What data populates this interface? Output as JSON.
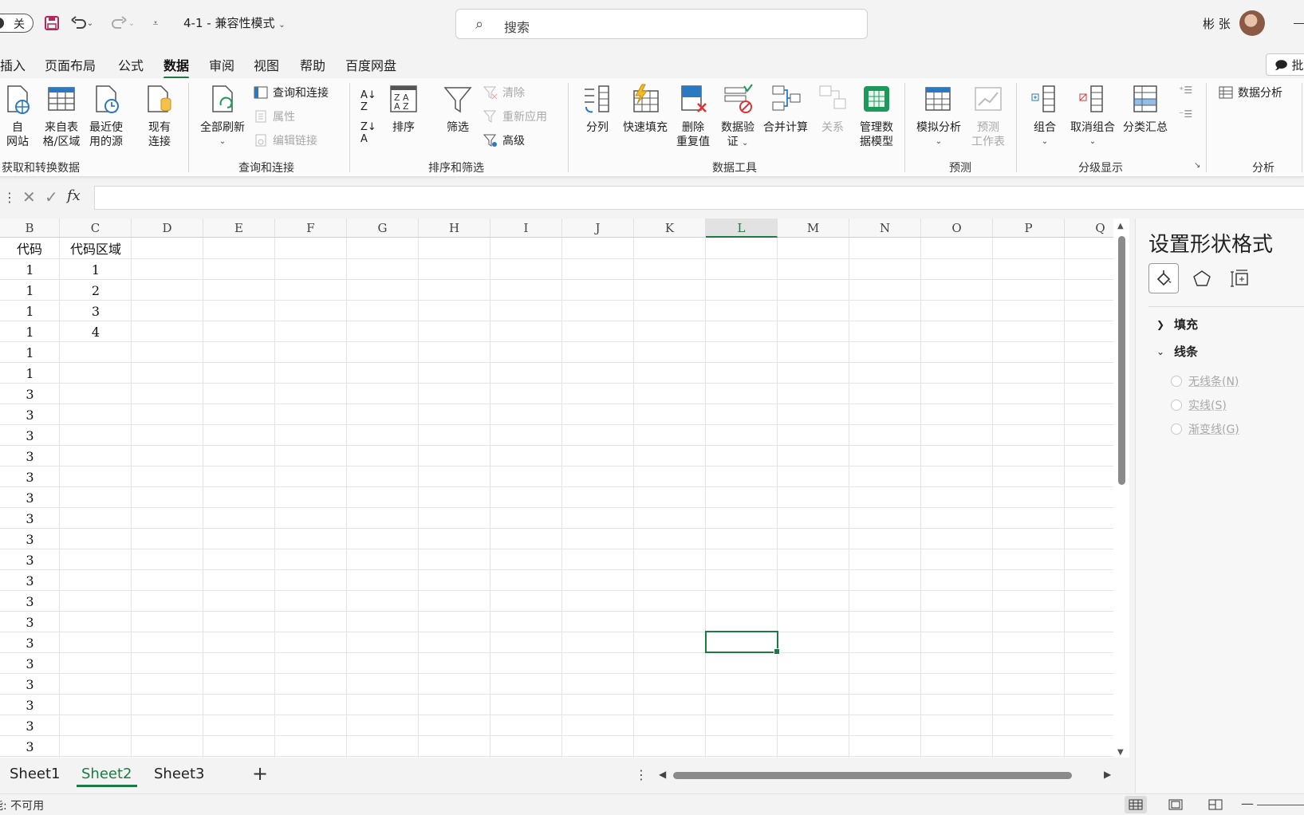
{
  "titlebar": {
    "autosave_label": "关",
    "doc_title": "4-1 - 兼容性模式",
    "search_placeholder": "搜索",
    "user_name": "彬 张"
  },
  "tabs": [
    {
      "label": "插入",
      "active": false
    },
    {
      "label": "页面布局",
      "active": false
    },
    {
      "label": "公式",
      "active": false
    },
    {
      "label": "数据",
      "active": true
    },
    {
      "label": "审阅",
      "active": false
    },
    {
      "label": "视图",
      "active": false
    },
    {
      "label": "帮助",
      "active": false
    },
    {
      "label": "百度网盘",
      "active": false
    }
  ],
  "comment_button": "批注",
  "ribbon": {
    "get_data": {
      "group_label": "获取和转换数据",
      "from_web": "自\n网站",
      "from_table": "来自表\n格/区域",
      "recent_sources": "最近使\n用的源",
      "existing_conn": "现有\n连接"
    },
    "queries": {
      "group_label": "查询和连接",
      "refresh_all": "全部刷新",
      "queries_conn": "查询和连接",
      "properties": "属性",
      "edit_links": "编辑链接"
    },
    "sort_filter": {
      "group_label": "排序和筛选",
      "sort": "排序",
      "filter": "筛选",
      "clear": "清除",
      "reapply": "重新应用",
      "advanced": "高级"
    },
    "data_tools": {
      "group_label": "数据工具",
      "text_to_columns": "分列",
      "flash_fill": "快速填充",
      "remove_duplicates": "删除\n重复值",
      "data_validation": "数据验\n证",
      "consolidate": "合并计算",
      "relationships": "关系",
      "manage_model": "管理数\n据模型"
    },
    "forecast": {
      "group_label": "预测",
      "what_if": "模拟分析",
      "forecast_sheet": "预测\n工作表"
    },
    "outline": {
      "group_label": "分级显示",
      "group": "组合",
      "ungroup": "取消组合",
      "subtotal": "分类汇总"
    },
    "analysis": {
      "group_label": "分析",
      "data_analysis": "数据分析"
    }
  },
  "grid": {
    "columns": [
      "B",
      "C",
      "D",
      "E",
      "F",
      "G",
      "H",
      "I",
      "J",
      "K",
      "L",
      "M",
      "N",
      "O",
      "P",
      "Q"
    ],
    "selected_column": "L",
    "header_row": [
      "代码",
      "代码区域"
    ],
    "col_b": [
      "1",
      "1",
      "1",
      "1",
      "1",
      "1",
      "3",
      "3",
      "3",
      "3",
      "3",
      "3",
      "3",
      "3",
      "3",
      "3",
      "3",
      "3",
      "3",
      "3",
      "3",
      "3",
      "3",
      "3"
    ],
    "col_c": [
      "1",
      "2",
      "3",
      "4"
    ]
  },
  "format_pane": {
    "title": "设置形状格式",
    "fill_section": "填充",
    "line_section": "线条",
    "options": [
      "无线条(N)",
      "实线(S)",
      "渐变线(G)"
    ]
  },
  "sheets": [
    {
      "label": "Sheet1",
      "active": false
    },
    {
      "label": "Sheet2",
      "active": true
    },
    {
      "label": "Sheet3",
      "active": false
    }
  ],
  "status": {
    "text": "辅助功能: 不可用"
  },
  "colors": {
    "accent": "#1d7a45",
    "ribbon_bg": "#fbfbfb",
    "disabled": "#a8a8a8"
  }
}
